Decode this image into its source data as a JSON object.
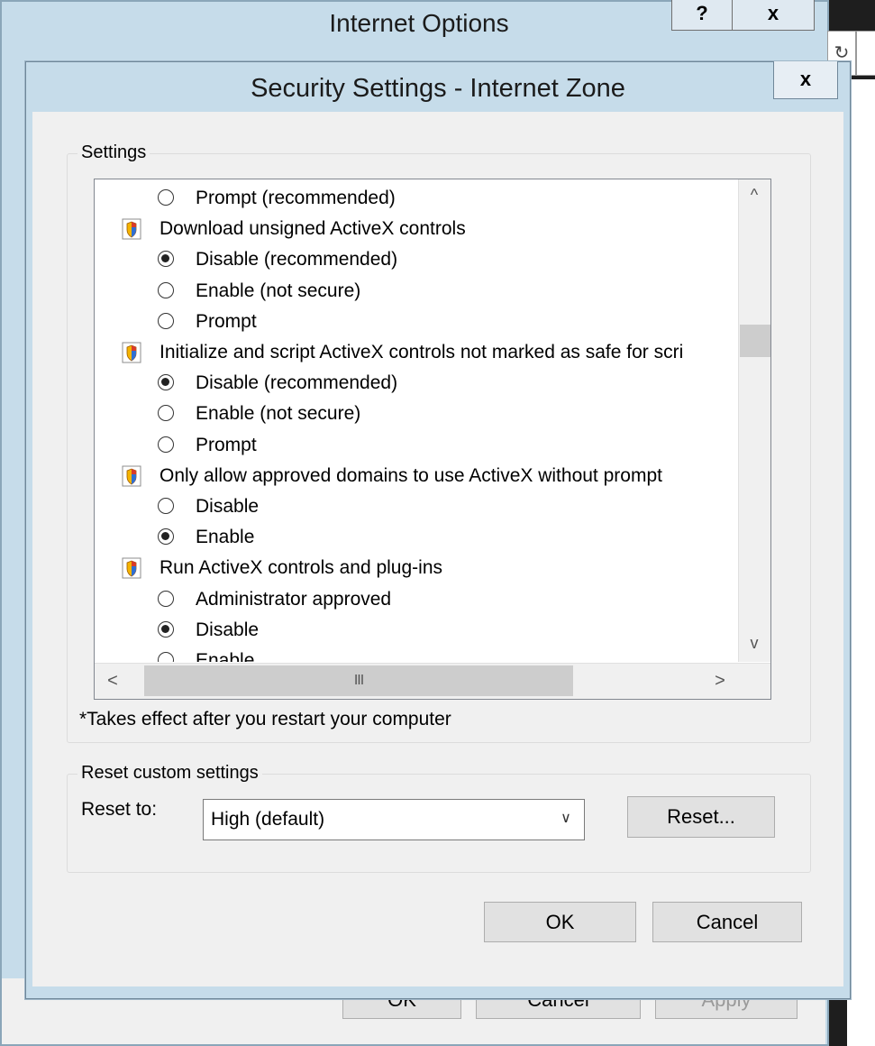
{
  "internet_options": {
    "title": "Internet Options",
    "help_label": "?",
    "close_label": "x",
    "ok_label": "OK",
    "cancel_label": "Cancel",
    "apply_label": "Apply"
  },
  "browser": {
    "refresh_icon": "refresh-icon"
  },
  "security_settings": {
    "title": "Security Settings - Internet Zone",
    "close_label": "x",
    "settings_group_label": "Settings",
    "tree": [
      {
        "type": "option",
        "label": "Prompt (recommended)",
        "checked": false
      },
      {
        "type": "category",
        "label": "Download unsigned ActiveX controls"
      },
      {
        "type": "option",
        "label": "Disable (recommended)",
        "checked": true
      },
      {
        "type": "option",
        "label": "Enable (not secure)",
        "checked": false
      },
      {
        "type": "option",
        "label": "Prompt",
        "checked": false
      },
      {
        "type": "category",
        "label": "Initialize and script ActiveX controls not marked as safe for scri"
      },
      {
        "type": "option",
        "label": "Disable (recommended)",
        "checked": true
      },
      {
        "type": "option",
        "label": "Enable (not secure)",
        "checked": false
      },
      {
        "type": "option",
        "label": "Prompt",
        "checked": false
      },
      {
        "type": "category",
        "label": "Only allow approved domains to use ActiveX without prompt"
      },
      {
        "type": "option",
        "label": "Disable",
        "checked": false
      },
      {
        "type": "option",
        "label": "Enable",
        "checked": true
      },
      {
        "type": "category",
        "label": "Run ActiveX controls and plug-ins"
      },
      {
        "type": "option",
        "label": "Administrator approved",
        "checked": false
      },
      {
        "type": "option",
        "label": "Disable",
        "checked": true
      },
      {
        "type": "option",
        "label": "Enable",
        "checked": false
      }
    ],
    "scroll": {
      "up": "^",
      "down": "v",
      "left": "<",
      "right": ">",
      "thumb_grip": "III"
    },
    "restart_note": "*Takes effect after you restart your computer",
    "reset": {
      "group_label": "Reset custom settings",
      "reset_to_label": "Reset to:",
      "selected_value": "High (default)",
      "reset_button": "Reset..."
    },
    "ok_label": "OK",
    "cancel_label": "Cancel"
  },
  "colors": {
    "title_bar": "#c6dcea",
    "client": "#f0f0f0",
    "button_face": "#e1e1e1"
  }
}
